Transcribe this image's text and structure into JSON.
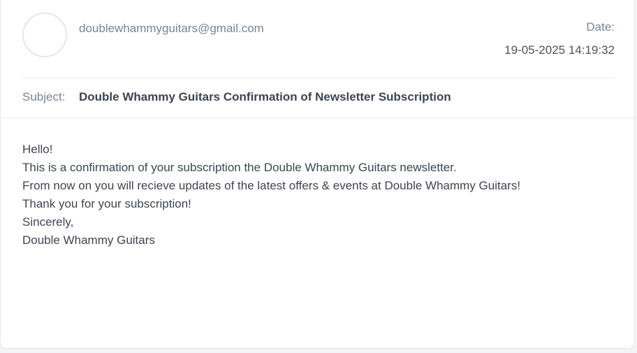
{
  "email": {
    "sender": "doublewhammyguitars@gmail.com",
    "date_label": "Date:",
    "date_value": "19-05-2025 14:19:32",
    "subject_label": "Subject:",
    "subject": "Double Whammy Guitars Confirmation of Newsletter Subscription",
    "body_lines": [
      "Hello!",
      "This is a confirmation of your subscription the Double Whammy Guitars newsletter.",
      "From now on you will recieve updates of the latest offers & events at Double Whammy Guitars!",
      "Thank you for your subscription!",
      "Sincerely,",
      "Double Whammy Guitars"
    ]
  }
}
